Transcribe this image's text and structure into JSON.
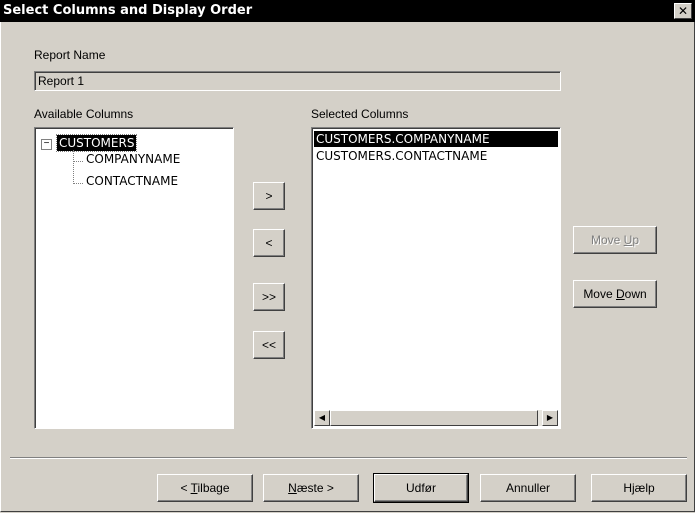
{
  "window": {
    "title": "Select Columns and Display Order",
    "close_glyph": "✕"
  },
  "report_name": {
    "label": "Report Name",
    "value": "Report 1"
  },
  "available": {
    "label": "Available Columns",
    "root": {
      "expander": "−",
      "label": "CUSTOMERS"
    },
    "children": [
      "COMPANYNAME",
      "CONTACTNAME"
    ]
  },
  "transfer_buttons": {
    "add": ">",
    "remove": "<",
    "add_all": ">>",
    "remove_all": "<<"
  },
  "selected": {
    "label": "Selected Columns",
    "items": [
      "CUSTOMERS.COMPANYNAME",
      "CUSTOMERS.CONTACTNAME"
    ],
    "scroll_left": "◀",
    "scroll_right": "▶"
  },
  "order_buttons": {
    "move_up_pre": "Move ",
    "move_up_key": "U",
    "move_up_post": "p",
    "move_down_pre": "Move ",
    "move_down_key": "D",
    "move_down_post": "own"
  },
  "footer": {
    "back_pre": "< ",
    "back_key": "T",
    "back_post": "ilbage",
    "next_key": "N",
    "next_post": "æste >",
    "finish": "Udfør",
    "cancel": "Annuller",
    "help": "Hjælp"
  }
}
